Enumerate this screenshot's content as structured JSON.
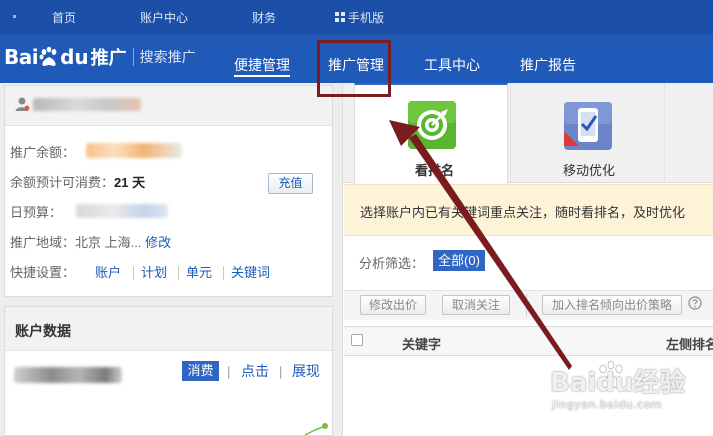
{
  "top_nav": {
    "items": [
      "首页",
      "账户中心",
      "财务",
      "手机版"
    ]
  },
  "logo": {
    "bai": "Bai",
    "du": "du",
    "tuiguang": "推广",
    "product": "搜索推广"
  },
  "main_nav": {
    "items": [
      "便捷管理",
      "推广管理",
      "工具中心",
      "推广报告"
    ],
    "active": "便捷管理"
  },
  "account_panel": {
    "balance_label": "推广余额：",
    "forecast_label": "余额预计可消费：",
    "forecast_value": "21 天",
    "recharge_button": "充值",
    "budget_label": "日预算：",
    "region_label": "推广地域：",
    "region_value": "北京 上海...",
    "region_edit": "修改",
    "quick_label": "快捷设置：",
    "quick_links": [
      "账户",
      "计划",
      "单元",
      "关键词"
    ]
  },
  "account_data": {
    "title": "账户数据",
    "tabs": [
      "消费",
      "点击",
      "展现"
    ],
    "active_tab": "消费"
  },
  "tools": {
    "items": [
      "看排名",
      "移动优化"
    ]
  },
  "notice": {
    "text": "选择账户内已有关键词重点关注，随时看排名，及时优化"
  },
  "filter": {
    "label": "分析筛选：",
    "all": "全部(0)"
  },
  "actions": {
    "buttons": [
      "修改出价",
      "取消关注",
      "加入排名倾向出价策略"
    ]
  },
  "table": {
    "headers": [
      "关键字",
      "左侧排名"
    ]
  },
  "watermark": {
    "text": "Baidu经验",
    "url": "jingyan.baidu.com"
  },
  "colors": {
    "nav_dark": "#1b4fa8",
    "nav": "#1f5ab8",
    "accent": "#2f66c4",
    "link": "#1e5bb5",
    "notice_bg": "#fdf3d9",
    "annotation": "#7a1c1f"
  }
}
